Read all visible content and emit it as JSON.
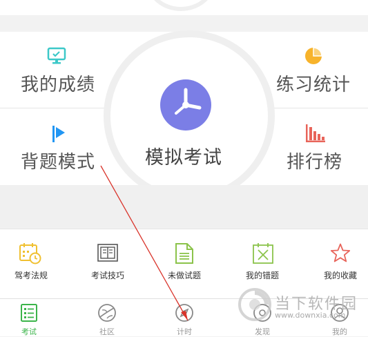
{
  "grid": {
    "my_scores": "我的成绩",
    "practice_stats": "练习统计",
    "recite_mode": "背题模式",
    "ranking": "排行榜",
    "mock_exam": "模拟考试"
  },
  "tools": [
    {
      "label": "驾考法规",
      "icon": "calendar-clock-icon"
    },
    {
      "label": "考试技巧",
      "icon": "book-icon"
    },
    {
      "label": "未做试题",
      "icon": "document-icon"
    },
    {
      "label": "我的错题",
      "icon": "x-box-icon"
    },
    {
      "label": "我的收藏",
      "icon": "star-icon"
    }
  ],
  "tabs": [
    {
      "label": "考试",
      "active": true
    },
    {
      "label": "社区",
      "active": false
    },
    {
      "label": "计时",
      "active": false
    },
    {
      "label": "发现",
      "active": false
    },
    {
      "label": "我的",
      "active": false
    }
  ],
  "watermark": {
    "name": "当下软件园",
    "url": "www.downxia.com"
  },
  "colors": {
    "accent_green": "#3bb44a",
    "clock_purple": "#7b7ee6",
    "teal": "#3cc8c8",
    "orange": "#f7b32b",
    "blue": "#2196f3",
    "red": "#e8645a",
    "yellow": "#f0c030",
    "olive": "#8bc34a",
    "arrow_red": "#d9342b"
  }
}
